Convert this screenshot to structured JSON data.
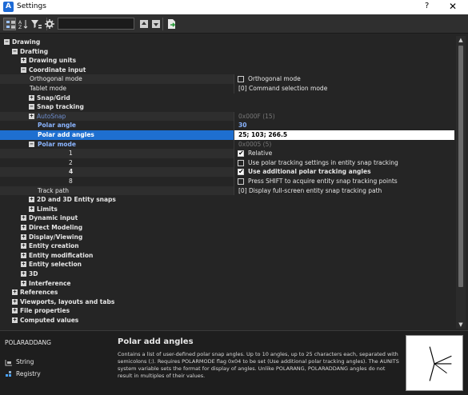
{
  "window": {
    "title": "Settings",
    "help_label": "?",
    "close_label": "✕"
  },
  "toolbar": {
    "search_value": "",
    "buttons": [
      "categorized-view",
      "alphabetical-view",
      "filter",
      "settings",
      "move-up",
      "move-down",
      "export"
    ]
  },
  "tree": {
    "drawing": "Drawing",
    "drafting": "Drafting",
    "drawing_units": "Drawing units",
    "coordinate_input": "Coordinate input",
    "orthogonal_mode": {
      "label": "Orthogonal mode",
      "value": "Orthogonal mode",
      "checked": false
    },
    "tablet_mode": {
      "label": "Tablet mode",
      "value": "[0] Command selection mode"
    },
    "snap_grid": "Snap/Grid",
    "snap_tracking": "Snap tracking",
    "autosnap": {
      "label": "AutoSnap",
      "value": "0x000F (15)"
    },
    "polar_angle": {
      "label": "Polar angle",
      "value": "30"
    },
    "polar_add_angles": {
      "label": "Polar add angles",
      "value": "25; 103; 266.5"
    },
    "polar_mode": {
      "label": "Polar mode",
      "value": "0x0005 (5)"
    },
    "flags": [
      {
        "num": "1",
        "label": "Relative",
        "checked": true,
        "bold": false
      },
      {
        "num": "2",
        "label": "Use polar tracking settings in entity snap tracking",
        "checked": false,
        "bold": false
      },
      {
        "num": "4",
        "label": "Use additional polar tracking angles",
        "checked": true,
        "bold": true
      },
      {
        "num": "8",
        "label": "Press SHIFT to acquire entity snap tracking points",
        "checked": false,
        "bold": false
      }
    ],
    "track_path": {
      "label": "Track path",
      "value": "[0] Display full-screen entity snap tracking path"
    },
    "snaps_2d_3d": "2D and 3D Entity snaps",
    "limits": "Limits",
    "dynamic_input": "Dynamic input",
    "direct_modeling": "Direct Modeling",
    "display_viewing": "Display/Viewing",
    "entity_creation": "Entity creation",
    "entity_modification": "Entity modification",
    "entity_selection": "Entity selection",
    "three_d": "3D",
    "interference": "Interference",
    "references": "References",
    "viewports": "Viewports, layouts and tabs",
    "file_properties": "File properties",
    "computed_values": "Computed values"
  },
  "info": {
    "variable": "POLARADDANG",
    "type": "String",
    "storage": "Registry",
    "title": "Polar add angles",
    "description": "Contains a list of user-defined polar snap angles. Up to 10 angles, up to 25 characters each, separated with semicolons (;). Requires POLARMODE flag 0x04 to be set (Use additional polar tracking angles). The AUNITS system variable sets the format for display of angles. Unlike POLARANG, POLARADDANG angles do not result in multiples of their values."
  },
  "colors": {
    "background": "#252525",
    "selection": "#1e6fd0",
    "highlight_text": "#8ab4ff"
  },
  "icons": {
    "expanded": "−",
    "collapsed": "+"
  }
}
